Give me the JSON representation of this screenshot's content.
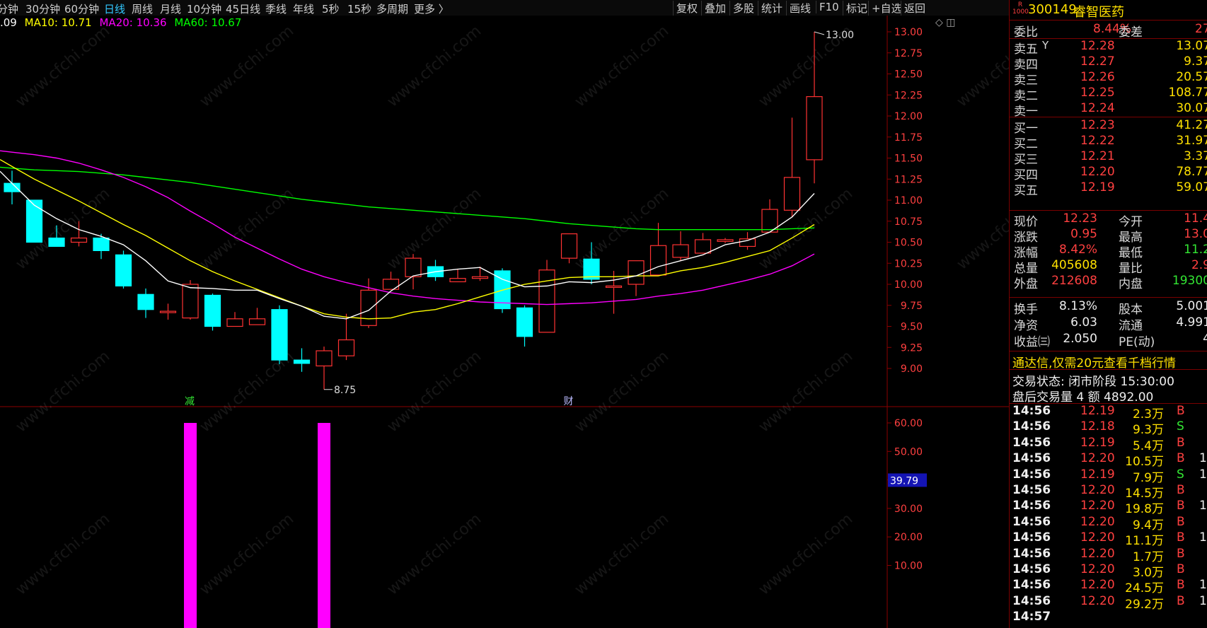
{
  "periods": {
    "tabs": [
      "分钟",
      "30分钟",
      "60分钟",
      "日线",
      "周线",
      "月线",
      "10分钟",
      "45日线",
      "季线",
      "年线",
      "5秒",
      "15秒",
      "多周期",
      "更多 〉"
    ],
    "active": "日线"
  },
  "toolbar": [
    "复权",
    "叠加",
    "多股",
    "统计",
    "画线",
    "F10",
    "标记",
    "+自选",
    "返回"
  ],
  "ma_legend": {
    "ma5": ".09",
    "ma10": "MA10: 10.71",
    "ma20": "MA20: 10.36",
    "ma60": "MA60: 10.67"
  },
  "colors": {
    "up": "#ff3232",
    "down": "#00ffff",
    "ma5": "#ffffff",
    "ma10": "#ffff00",
    "ma20": "#ff00ff",
    "ma60": "#00ff00",
    "volume": "#ff00ff",
    "price_axis": "#ff4040",
    "frame": "#8b0000"
  },
  "price_axis": {
    "min": 9.0,
    "max": 13.0,
    "ticks": [
      "13.00",
      "12.75",
      "12.50",
      "12.25",
      "12.00",
      "11.75",
      "11.50",
      "11.25",
      "11.00",
      "10.75",
      "10.50",
      "10.25",
      "10.00",
      "9.75",
      "9.50",
      "9.25",
      "9.00"
    ]
  },
  "high_label": "13.00",
  "low_label": "8.75",
  "event_marks": [
    "减",
    "财"
  ],
  "candles": [
    {
      "o": 11.2,
      "c": 11.1,
      "h": 11.35,
      "l": 10.95
    },
    {
      "o": 11.0,
      "c": 10.5,
      "h": 11.0,
      "l": 10.5
    },
    {
      "o": 10.55,
      "c": 10.45,
      "h": 10.7,
      "l": 10.45
    },
    {
      "o": 10.5,
      "c": 10.55,
      "h": 10.75,
      "l": 10.45
    },
    {
      "o": 10.55,
      "c": 10.4,
      "h": 10.6,
      "l": 10.3
    },
    {
      "o": 10.35,
      "c": 9.98,
      "h": 10.4,
      "l": 9.95
    },
    {
      "o": 9.88,
      "c": 9.7,
      "h": 9.95,
      "l": 9.6
    },
    {
      "o": 9.68,
      "c": 9.68,
      "h": 9.77,
      "l": 9.58
    },
    {
      "o": 9.6,
      "c": 10.0,
      "h": 10.05,
      "l": 9.58
    },
    {
      "o": 9.87,
      "c": 9.5,
      "h": 9.89,
      "l": 9.45
    },
    {
      "o": 9.5,
      "c": 9.59,
      "h": 9.67,
      "l": 9.5
    },
    {
      "o": 9.52,
      "c": 9.59,
      "h": 9.72,
      "l": 9.52
    },
    {
      "o": 9.7,
      "c": 9.1,
      "h": 9.75,
      "l": 9.05
    },
    {
      "o": 9.1,
      "c": 9.06,
      "h": 9.24,
      "l": 8.96
    },
    {
      "o": 9.03,
      "c": 9.21,
      "h": 9.26,
      "l": 8.75
    },
    {
      "o": 9.15,
      "c": 9.34,
      "h": 9.65,
      "l": 9.1
    },
    {
      "o": 9.51,
      "c": 9.93,
      "h": 10.07,
      "l": 9.48
    },
    {
      "o": 9.94,
      "c": 10.06,
      "h": 10.15,
      "l": 9.94
    },
    {
      "o": 10.09,
      "c": 10.31,
      "h": 10.36,
      "l": 9.94
    },
    {
      "o": 10.21,
      "c": 10.09,
      "h": 10.29,
      "l": 10.04
    },
    {
      "o": 10.03,
      "c": 10.07,
      "h": 10.18,
      "l": 10.03
    },
    {
      "o": 10.07,
      "c": 10.09,
      "h": 10.21,
      "l": 10.04
    },
    {
      "o": 10.16,
      "c": 9.71,
      "h": 10.19,
      "l": 9.66
    },
    {
      "o": 9.72,
      "c": 9.38,
      "h": 9.75,
      "l": 9.26
    },
    {
      "o": 9.43,
      "c": 10.17,
      "h": 10.29,
      "l": 9.43
    },
    {
      "o": 10.31,
      "c": 10.6,
      "h": 10.6,
      "l": 10.25
    },
    {
      "o": 10.3,
      "c": 10.06,
      "h": 10.5,
      "l": 10.0
    },
    {
      "o": 9.98,
      "c": 9.98,
      "h": 10.16,
      "l": 9.65
    },
    {
      "o": 10.0,
      "c": 10.28,
      "h": 10.28,
      "l": 9.86
    },
    {
      "o": 10.11,
      "c": 10.46,
      "h": 10.73,
      "l": 10.11
    },
    {
      "o": 10.32,
      "c": 10.47,
      "h": 10.63,
      "l": 10.28
    },
    {
      "o": 10.37,
      "c": 10.53,
      "h": 10.61,
      "l": 10.37
    },
    {
      "o": 10.51,
      "c": 10.53,
      "h": 10.55,
      "l": 10.49
    },
    {
      "o": 10.45,
      "c": 10.54,
      "h": 10.62,
      "l": 10.41
    },
    {
      "o": 10.62,
      "c": 10.89,
      "h": 11.01,
      "l": 10.62
    },
    {
      "o": 10.88,
      "c": 11.27,
      "h": 11.98,
      "l": 10.8
    },
    {
      "o": 11.48,
      "c": 12.23,
      "h": 13.0,
      "l": 11.2
    }
  ],
  "ma5_line": [
    11.2,
    10.94,
    10.78,
    10.65,
    10.57,
    10.47,
    10.28,
    10.04,
    9.96,
    9.95,
    9.93,
    9.93,
    9.83,
    9.74,
    9.62,
    9.59,
    9.69,
    9.92,
    10.1,
    10.15,
    10.18,
    10.2,
    10.06,
    9.97,
    9.98,
    10.03,
    10.02,
    10.05,
    10.1,
    10.21,
    10.28,
    10.35,
    10.47,
    10.52,
    10.62,
    10.8,
    11.08
  ],
  "ma10_line": [
    11.4,
    11.25,
    11.12,
    10.99,
    10.85,
    10.71,
    10.58,
    10.43,
    10.28,
    10.15,
    10.04,
    9.94,
    9.84,
    9.74,
    9.65,
    9.61,
    9.59,
    9.6,
    9.67,
    9.7,
    9.77,
    9.85,
    9.93,
    10.0,
    10.04,
    10.08,
    10.09,
    10.09,
    10.1,
    10.1,
    10.16,
    10.2,
    10.26,
    10.33,
    10.4,
    10.55,
    10.71
  ],
  "ma20_line": [
    11.57,
    11.54,
    11.5,
    11.44,
    11.36,
    11.27,
    11.16,
    11.03,
    10.87,
    10.72,
    10.56,
    10.43,
    10.3,
    10.18,
    10.09,
    10.02,
    9.96,
    9.9,
    9.86,
    9.83,
    9.81,
    9.79,
    9.78,
    9.77,
    9.76,
    9.77,
    9.78,
    9.8,
    9.82,
    9.86,
    9.89,
    9.93,
    9.99,
    10.05,
    10.12,
    10.22,
    10.36
  ],
  "ma60_line": [
    11.38,
    11.36,
    11.35,
    11.34,
    11.32,
    11.3,
    11.27,
    11.24,
    11.21,
    11.17,
    11.13,
    11.09,
    11.05,
    11.01,
    10.98,
    10.95,
    10.92,
    10.9,
    10.88,
    10.86,
    10.84,
    10.82,
    10.8,
    10.78,
    10.75,
    10.72,
    10.7,
    10.68,
    10.66,
    10.65,
    10.65,
    10.65,
    10.65,
    10.65,
    10.65,
    10.66,
    10.67
  ],
  "indicator": {
    "axis_ticks": [
      "60.00",
      "50.00",
      "40.00",
      "30.00",
      "20.00",
      "10.00"
    ],
    "current": "39.79",
    "bars": [
      {
        "index": 8,
        "value": 60
      },
      {
        "index": 14,
        "value": 60
      }
    ]
  },
  "quote": {
    "badge_top": "R",
    "badge_bottom": "1000",
    "code": "300149",
    "name": "睿智医药",
    "weibi_label": "委比",
    "weibi_value": "8.44%",
    "weicha_label": "委差",
    "weicha_value": "27",
    "asks": [
      {
        "label": "卖五",
        "flag": "Y",
        "price": "12.28",
        "vol": "13.07"
      },
      {
        "label": "卖四",
        "price": "12.27",
        "vol": "9.37"
      },
      {
        "label": "卖三",
        "price": "12.26",
        "vol": "20.57"
      },
      {
        "label": "卖二",
        "price": "12.25",
        "vol": "108.77"
      },
      {
        "label": "卖一",
        "price": "12.24",
        "vol": "30.07"
      }
    ],
    "bids": [
      {
        "label": "买一",
        "price": "12.23",
        "vol": "41.27"
      },
      {
        "label": "买二",
        "price": "12.22",
        "vol": "31.97"
      },
      {
        "label": "买三",
        "price": "12.21",
        "vol": "3.37"
      },
      {
        "label": "买四",
        "price": "12.20",
        "vol": "78.77"
      },
      {
        "label": "买五",
        "price": "12.19",
        "vol": "59.07"
      }
    ],
    "stats": [
      {
        "l1": "现价",
        "v1": "12.23",
        "c1": "red",
        "l2": "今开",
        "v2": "11.4",
        "c2": "red"
      },
      {
        "l1": "涨跌",
        "v1": "0.95",
        "c1": "red",
        "l2": "最高",
        "v2": "13.0",
        "c2": "red"
      },
      {
        "l1": "涨幅",
        "v1": "8.42%",
        "c1": "red",
        "l2": "最低",
        "v2": "11.2",
        "c2": "green"
      },
      {
        "l1": "总量",
        "v1": "405608",
        "c1": "yel",
        "l2": "量比",
        "v2": "2.9",
        "c2": "red"
      },
      {
        "l1": "外盘",
        "v1": "212608",
        "c1": "red",
        "l2": "内盘",
        "v2": "19300",
        "c2": "green"
      }
    ],
    "stats2": [
      {
        "l1": "换手",
        "v1": "8.13%",
        "l2": "股本",
        "v2": "5.001"
      },
      {
        "l1": "净资",
        "v1": "6.03",
        "l2": "流通",
        "v2": "4.991"
      },
      {
        "l1": "收益㈢",
        "v1": "2.050",
        "l2": "PE(动)",
        "v2": "4"
      }
    ],
    "promo": "通达信,仅需20元查看千档行情",
    "trade_status": "交易状态: 闭市阶段 15:30:00",
    "after_hours": "盘后交易量 4 额 4892.00"
  },
  "ticks": [
    {
      "t": "14:56",
      "p": "12.19",
      "v": "2.3万",
      "s": "B",
      "x": ""
    },
    {
      "t": "14:56",
      "p": "12.18",
      "v": "9.3万",
      "s": "S",
      "x": ""
    },
    {
      "t": "14:56",
      "p": "12.19",
      "v": "5.4万",
      "s": "B",
      "x": ""
    },
    {
      "t": "14:56",
      "p": "12.20",
      "v": "10.5万",
      "s": "B",
      "x": "1"
    },
    {
      "t": "14:56",
      "p": "12.19",
      "v": "7.9万",
      "s": "S",
      "x": "1"
    },
    {
      "t": "14:56",
      "p": "12.20",
      "v": "14.5万",
      "s": "B",
      "x": ""
    },
    {
      "t": "14:56",
      "p": "12.20",
      "v": "19.8万",
      "s": "B",
      "x": "1"
    },
    {
      "t": "14:56",
      "p": "12.20",
      "v": "9.4万",
      "s": "B",
      "x": ""
    },
    {
      "t": "14:56",
      "p": "12.20",
      "v": "11.1万",
      "s": "B",
      "x": "1"
    },
    {
      "t": "14:56",
      "p": "12.20",
      "v": "1.7万",
      "s": "B",
      "x": ""
    },
    {
      "t": "14:56",
      "p": "12.20",
      "v": "3.0万",
      "s": "B",
      "x": ""
    },
    {
      "t": "14:56",
      "p": "12.20",
      "v": "24.5万",
      "s": "B",
      "x": "1"
    },
    {
      "t": "14:56",
      "p": "12.20",
      "v": "29.2万",
      "s": "B",
      "x": "1"
    },
    {
      "t": "14:57",
      "p": "",
      "v": "",
      "s": "",
      "x": ""
    }
  ],
  "watermark": "www.cfchi.com"
}
